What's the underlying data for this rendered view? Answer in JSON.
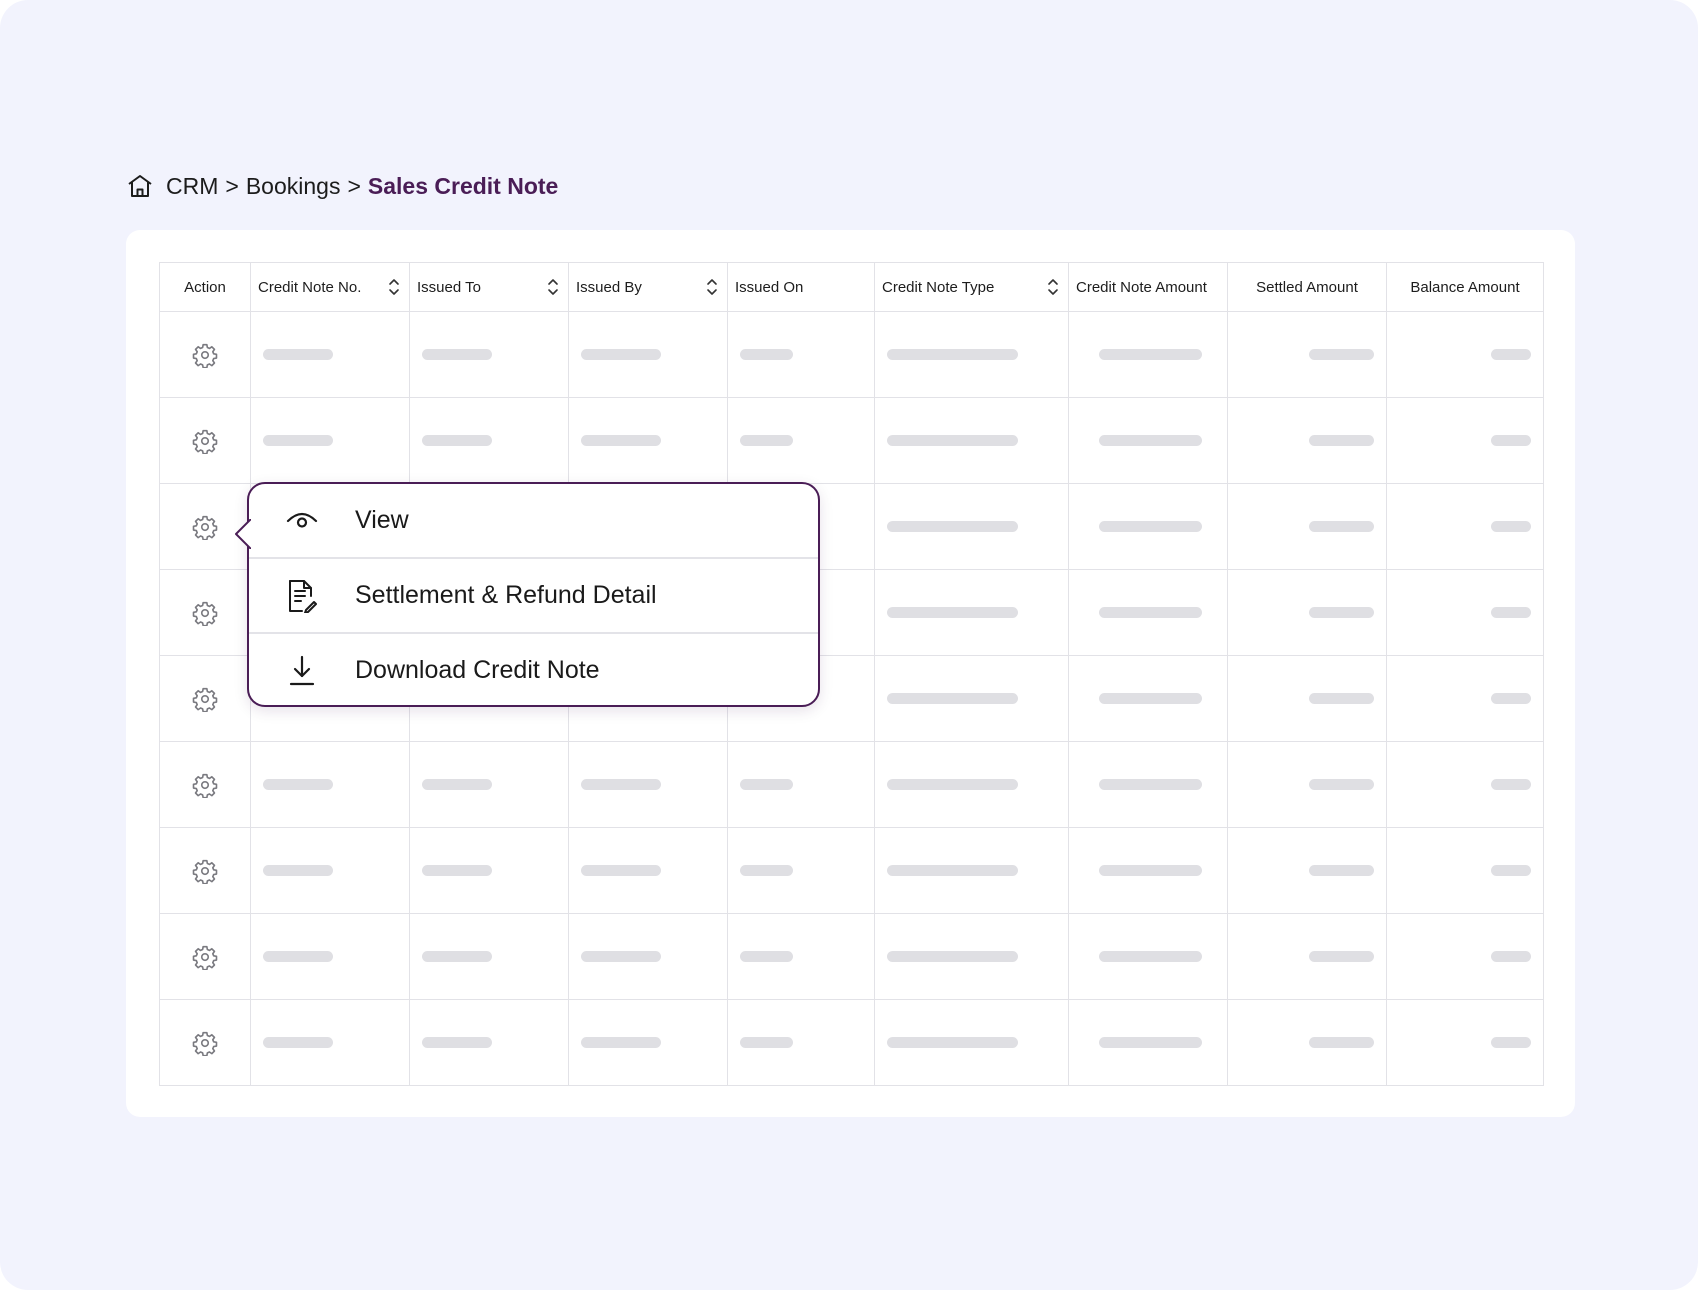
{
  "breadcrumb": {
    "items": [
      "CRM",
      "Bookings"
    ],
    "separator": ">",
    "current": "Sales Credit Note"
  },
  "table": {
    "columns": [
      {
        "label": "Action",
        "sortable": false
      },
      {
        "label": "Credit Note No.",
        "sortable": true
      },
      {
        "label": "Issued To",
        "sortable": true
      },
      {
        "label": "Issued By",
        "sortable": true
      },
      {
        "label": "Issued On",
        "sortable": false
      },
      {
        "label": "Credit Note Type",
        "sortable": true
      },
      {
        "label": "Credit Note Amount",
        "sortable": false
      },
      {
        "label": "Settled Amount",
        "sortable": false
      },
      {
        "label": "Balance Amount",
        "sortable": false
      }
    ],
    "row_count": 9,
    "row_icon": "gear-icon",
    "cells_state": "loading-placeholder"
  },
  "action_menu": {
    "open_on_row": 3,
    "items": [
      {
        "label": "View",
        "icon": "eye-icon"
      },
      {
        "label": "Settlement & Refund Detail",
        "icon": "document-edit-icon"
      },
      {
        "label": "Download Credit Note",
        "icon": "download-icon"
      }
    ]
  },
  "colors": {
    "accent": "#4a1d56",
    "background": "#f2f3fd",
    "placeholder": "#dfdfe3",
    "border": "#e2e2e7"
  }
}
